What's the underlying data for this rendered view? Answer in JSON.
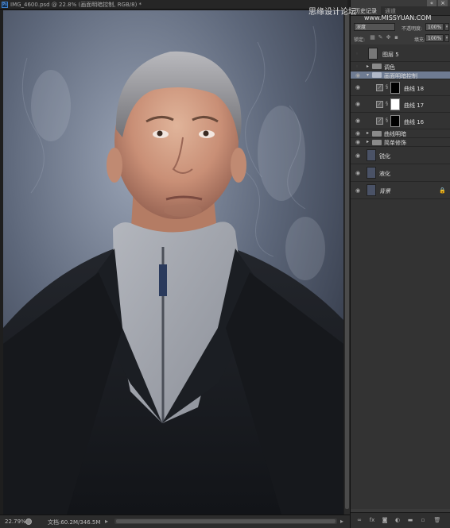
{
  "document": {
    "tab_title": "IMG_4600.psd @ 22.8% (画面明暗控制, RGB/8) *",
    "ps_badge": "Ps"
  },
  "status_bar": {
    "zoom": "22.79%",
    "doc_size": "文档:60.2M/346.5M"
  },
  "panel": {
    "tabs": [
      "历史记录",
      "通道"
    ],
    "window_buttons": [
      "«",
      "×"
    ],
    "blend_mode": "深度",
    "opacity_label": "不透明度:",
    "opacity_value": "100%",
    "lock_label": "锁定:",
    "fill_label": "填充:",
    "fill_value": "100%"
  },
  "layers": [
    {
      "name": "图层 5",
      "type": "layer",
      "thumb": "#777"
    },
    {
      "name": "调色",
      "type": "group",
      "expanded": false
    },
    {
      "name": "画面明暗控制",
      "type": "group",
      "expanded": true,
      "selected": true
    },
    {
      "name": "曲线 18",
      "type": "curves"
    },
    {
      "name": "曲线 17",
      "type": "curves"
    },
    {
      "name": "曲线 16",
      "type": "curves"
    },
    {
      "name": "曲线明暗",
      "type": "group",
      "expanded": false
    },
    {
      "name": "简单修饰",
      "type": "group",
      "expanded": false
    },
    {
      "name": "锐化",
      "type": "layer"
    },
    {
      "name": "液化",
      "type": "layer"
    },
    {
      "name": "背景",
      "type": "background",
      "locked": true
    }
  ],
  "watermark": {
    "text": "思缘设计论坛",
    "url": "www.MISSYUAN.COM"
  },
  "colors": {
    "selected_layer": "#6e7b92",
    "panel_bg": "#3a3a3a",
    "canvas_wall": "#5a6476"
  }
}
